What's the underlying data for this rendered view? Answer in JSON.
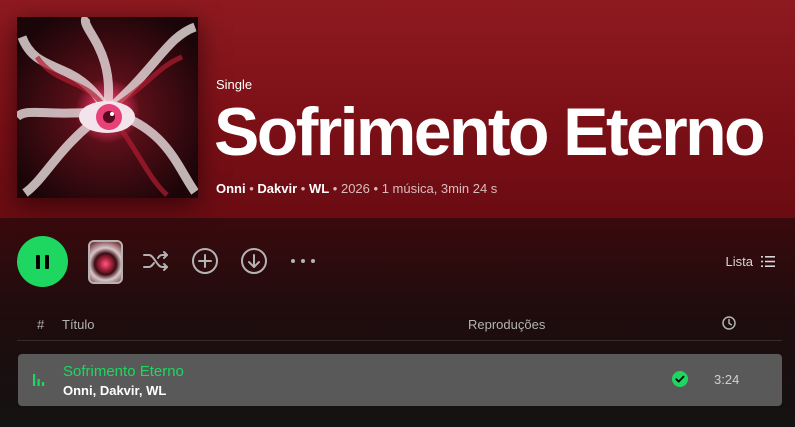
{
  "album": {
    "type_label": "Single",
    "title": "Sofrimento Eterno",
    "artists": [
      "Onni",
      "Dakvir",
      "WL"
    ],
    "year": "2026",
    "summary": "1 música, 3min 24 s"
  },
  "actions": {
    "list_label": "Lista"
  },
  "table": {
    "headers": {
      "num": "#",
      "title": "Título",
      "plays": "Reproduções"
    },
    "rows": [
      {
        "title": "Sofrimento Eterno",
        "artists": "Onni, Dakvir, WL",
        "duration": "3:24",
        "playing": true,
        "saved": true
      }
    ]
  },
  "colors": {
    "accent": "#1ed760",
    "hero": "#8e1a20",
    "row_highlight": "#595959"
  }
}
